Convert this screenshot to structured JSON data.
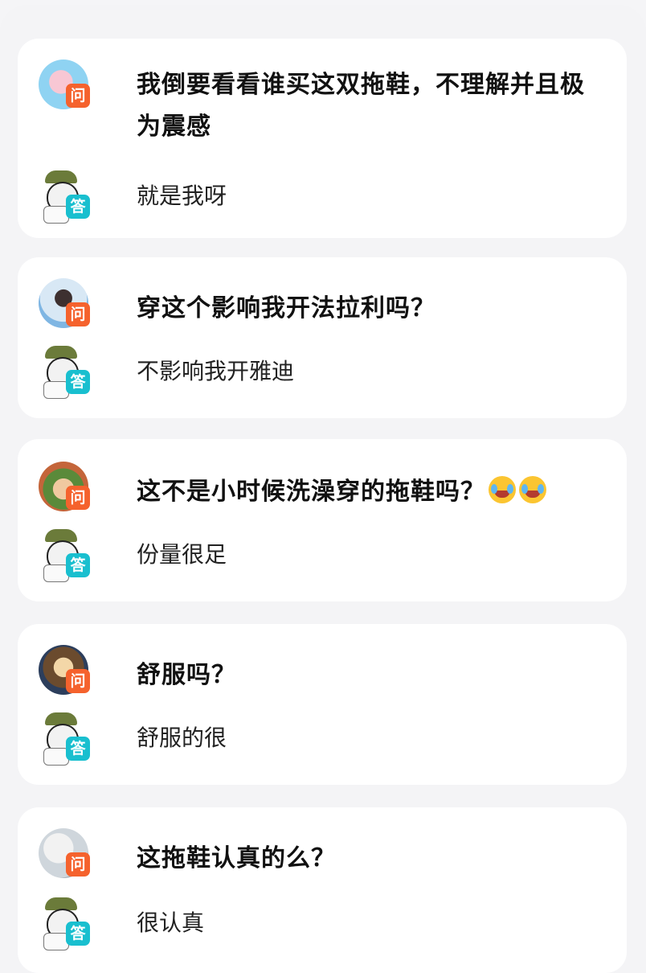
{
  "items": [
    {
      "question": "我倒要看看谁买这双拖鞋，不理解并且极为震感",
      "answer": "就是我呀",
      "q_badge": "问",
      "a_badge": "答"
    },
    {
      "question": "穿这个影响我开法拉利吗？",
      "answer": "不影响我开雅迪",
      "q_badge": "问",
      "a_badge": "答"
    },
    {
      "question": "这不是小时候洗澡穿的拖鞋吗？",
      "question_emoji": "😂😂",
      "answer": "份量很足",
      "q_badge": "问",
      "a_badge": "答"
    },
    {
      "question": "舒服吗？",
      "answer": "舒服的很",
      "q_badge": "问",
      "a_badge": "答"
    },
    {
      "question": "这拖鞋认真的么？",
      "answer": "很认真",
      "q_badge": "问",
      "a_badge": "答"
    }
  ],
  "colors": {
    "question_badge": "#f5622d",
    "answer_badge": "#19bfcf",
    "card_bg": "#ffffff",
    "page_bg": "#f4f4f6"
  },
  "icons": {
    "question_avatar": "user-avatar-icon",
    "answer_avatar": "soldier-meme-avatar-icon",
    "emoji": "tears-of-joy-emoji-icon"
  }
}
